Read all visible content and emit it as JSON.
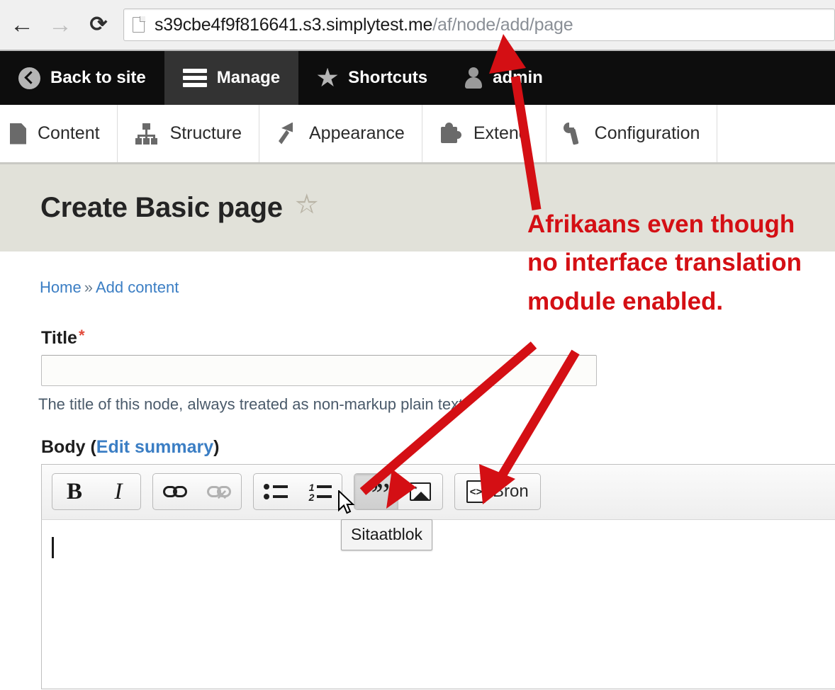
{
  "browser": {
    "back_label": "Back",
    "forward_label": "Forward",
    "reload_label": "Reload",
    "url_domain": "s39cbe4f9f816641.s3.simplytest.me",
    "url_path": "/af/node/add/page",
    "page_icon": "page-icon"
  },
  "admin_toolbar": {
    "items": [
      {
        "label": "Back to site",
        "icon": "back-circle-icon",
        "active": false
      },
      {
        "label": "Manage",
        "icon": "hamburger-menu-icon",
        "active": true
      },
      {
        "label": "Shortcuts",
        "icon": "star-icon",
        "active": false
      },
      {
        "label": "admin",
        "icon": "user-icon",
        "active": false
      }
    ]
  },
  "admin_tray": {
    "items": [
      {
        "label": "Content",
        "icon": "file-icon"
      },
      {
        "label": "Structure",
        "icon": "hierarchy-icon"
      },
      {
        "label": "Appearance",
        "icon": "paintbrush-icon"
      },
      {
        "label": "Extend",
        "icon": "puzzle-piece-icon"
      },
      {
        "label": "Configuration",
        "icon": "wrench-icon"
      }
    ]
  },
  "page": {
    "title": "Create Basic page",
    "title_star_icon": "star-outline-icon",
    "breadcrumb": {
      "home": "Home",
      "separator": "»",
      "current": "Add content"
    }
  },
  "form": {
    "title_label": "Title",
    "title_required_marker": "*",
    "title_value": "",
    "title_description": "The title of this node, always treated as non-markup plain text.",
    "body_label": "Body (",
    "body_edit_summary_link": "Edit summary",
    "body_label_close": ")",
    "body_value": ""
  },
  "editor": {
    "toolbar_groups": [
      {
        "buttons": [
          {
            "name": "bold-button",
            "glyph": "B",
            "icon": "bold-icon",
            "state": "normal"
          },
          {
            "name": "italic-button",
            "glyph": "I",
            "icon": "italic-icon",
            "state": "normal"
          }
        ]
      },
      {
        "buttons": [
          {
            "name": "link-button",
            "icon": "link-icon",
            "state": "normal"
          },
          {
            "name": "unlink-button",
            "icon": "unlink-icon",
            "state": "disabled"
          }
        ]
      },
      {
        "buttons": [
          {
            "name": "bulleted-list-button",
            "icon": "bulleted-list-icon",
            "state": "normal"
          },
          {
            "name": "numbered-list-button",
            "icon": "numbered-list-icon",
            "state": "normal"
          }
        ]
      },
      {
        "buttons": [
          {
            "name": "blockquote-button",
            "icon": "blockquote-icon",
            "state": "hovered"
          },
          {
            "name": "image-button",
            "icon": "image-icon",
            "state": "normal"
          }
        ]
      },
      {
        "buttons": [
          {
            "name": "source-button",
            "icon": "source-code-icon",
            "label": "Bron",
            "state": "normal"
          }
        ]
      }
    ],
    "tooltip_text": "Sitaatblok",
    "ol_marker_1": "1",
    "ol_marker_2": "2",
    "source_icon_glyph": "<>",
    "bron_label": "Bron"
  },
  "annotation": {
    "text": "Afrikaans even though no interface translation module enabled.",
    "color": "#d40f14",
    "arrows": 3
  },
  "colors": {
    "admin_bar_bg": "#0d0d0d",
    "admin_bar_active_bg": "#333333",
    "page_header_bg": "#e1e1d9",
    "link_blue": "#3b7ec4",
    "required_red": "#e24a3b",
    "annotation_red": "#d40f14"
  }
}
